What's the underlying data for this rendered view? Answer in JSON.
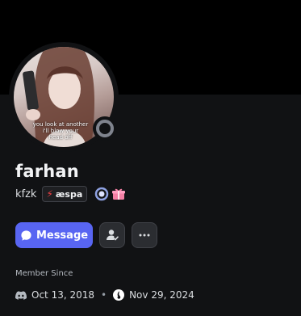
{
  "profile": {
    "display_name": "farhan",
    "username": "kfzk",
    "tag": "æspa",
    "avatar_caption": "you look at another\ni'll blow your\nhead off"
  },
  "actions": {
    "message_label": "Message"
  },
  "member": {
    "label": "Member Since",
    "discord_date": "Oct 13, 2018",
    "separator": "•",
    "server_date": "Nov 29, 2024"
  },
  "icons": {
    "status": "offline-status-icon",
    "tag": "lightning-icon",
    "badge1": "nitro-badge-icon",
    "badge2": "gift-badge-icon",
    "message": "chat-bubble-icon",
    "friend": "add-friend-icon",
    "more": "more-dots-icon",
    "discord": "discord-icon",
    "server": "server-icon"
  },
  "colors": {
    "background": "#111214",
    "banner": "#000000",
    "accent": "#5865f2",
    "status_offline": "#80848e"
  }
}
